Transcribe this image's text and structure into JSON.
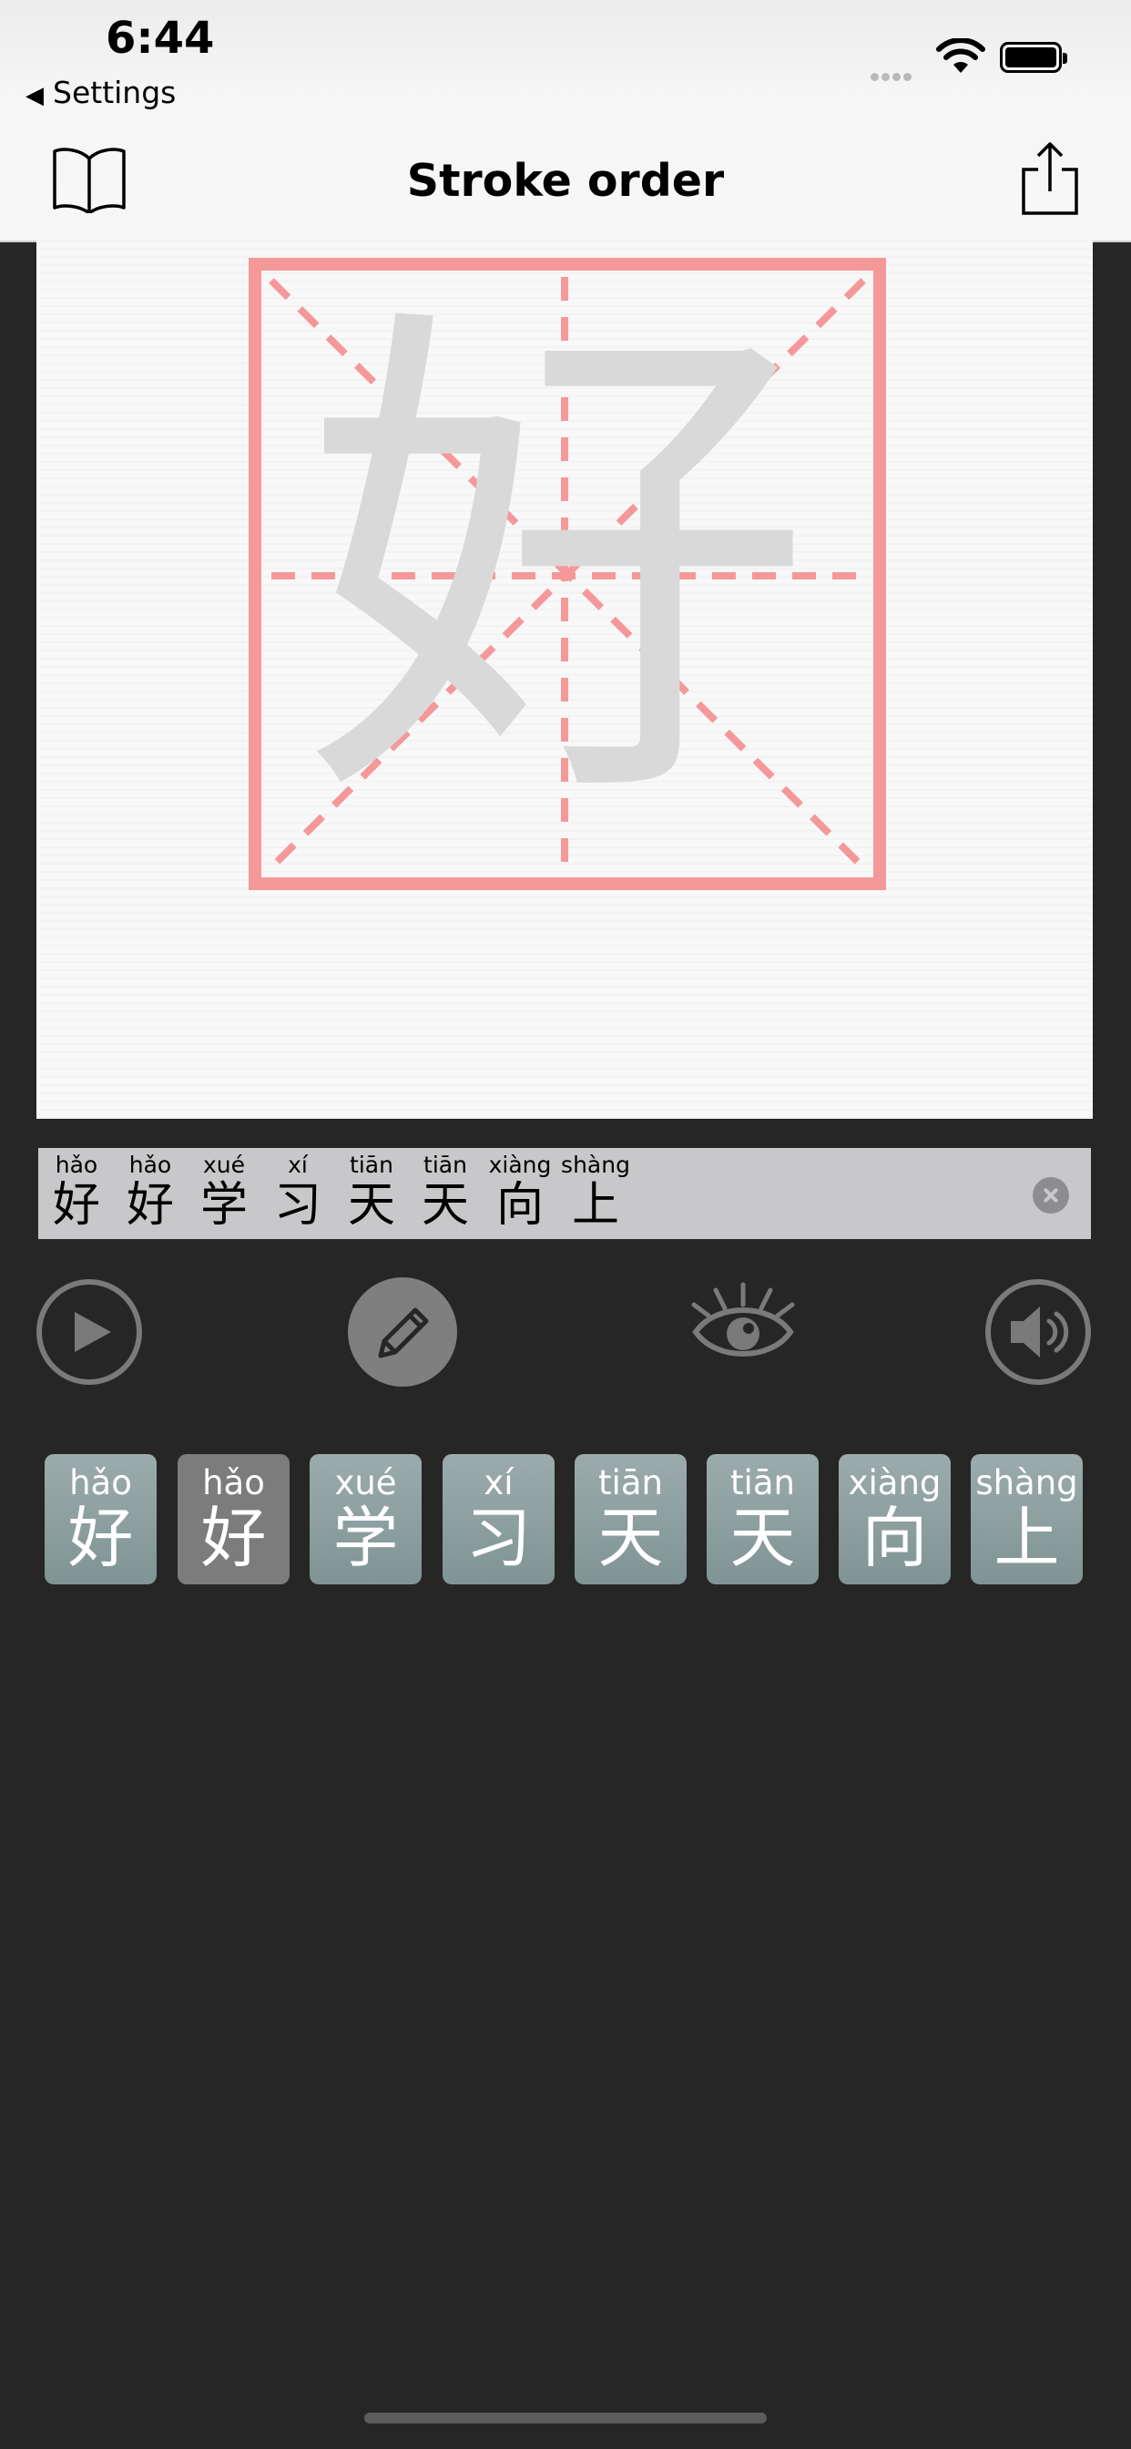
{
  "status": {
    "time": "6:44",
    "back_label": "Settings"
  },
  "nav": {
    "title": "Stroke order",
    "left_icon": "book-icon",
    "right_icon": "share-icon"
  },
  "canvas": {
    "character": "好",
    "grid_color": "#f5989a"
  },
  "strip": {
    "items": [
      {
        "pinyin": "hǎo",
        "hanzi": "好"
      },
      {
        "pinyin": "hǎo",
        "hanzi": "好"
      },
      {
        "pinyin": "xué",
        "hanzi": "学"
      },
      {
        "pinyin": "xí",
        "hanzi": "习"
      },
      {
        "pinyin": "tiān",
        "hanzi": "天"
      },
      {
        "pinyin": "tiān",
        "hanzi": "天"
      },
      {
        "pinyin": "xiàng",
        "hanzi": "向"
      },
      {
        "pinyin": "shàng",
        "hanzi": "上"
      }
    ]
  },
  "controls": [
    "play-icon",
    "pencil-icon",
    "eye-icon",
    "speaker-icon"
  ],
  "tiles": [
    {
      "pinyin": "hǎo",
      "hanzi": "好",
      "selected": false
    },
    {
      "pinyin": "hǎo",
      "hanzi": "好",
      "selected": true
    },
    {
      "pinyin": "xué",
      "hanzi": "学",
      "selected": false
    },
    {
      "pinyin": "xí",
      "hanzi": "习",
      "selected": false
    },
    {
      "pinyin": "tiān",
      "hanzi": "天",
      "selected": false
    },
    {
      "pinyin": "tiān",
      "hanzi": "天",
      "selected": false
    },
    {
      "pinyin": "xiàng",
      "hanzi": "向",
      "selected": false
    },
    {
      "pinyin": "shàng",
      "hanzi": "上",
      "selected": false
    }
  ]
}
